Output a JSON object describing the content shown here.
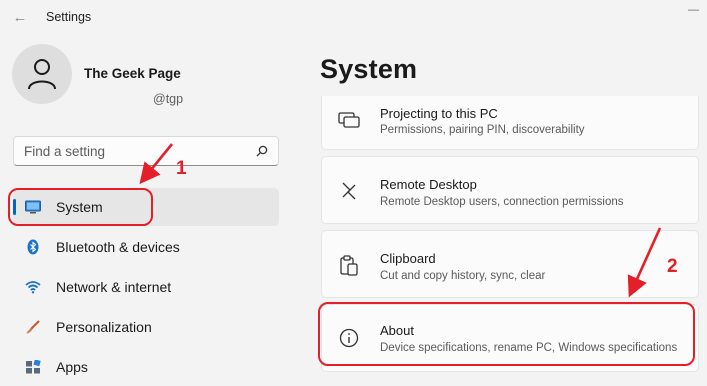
{
  "window": {
    "title": "Settings",
    "back_glyph": "←",
    "minimize_glyph": "—"
  },
  "user": {
    "name": "The Geek Page",
    "handle": "@tgp"
  },
  "search": {
    "placeholder": "Find a setting"
  },
  "nav": {
    "items": [
      {
        "label": "System",
        "icon": "monitor-icon",
        "selected": true
      },
      {
        "label": "Bluetooth & devices",
        "icon": "bluetooth-icon"
      },
      {
        "label": "Network & internet",
        "icon": "wifi-icon"
      },
      {
        "label": "Personalization",
        "icon": "brush-icon"
      },
      {
        "label": "Apps",
        "icon": "apps-icon"
      }
    ]
  },
  "main": {
    "title": "System",
    "cards": [
      {
        "title": "Projecting to this PC",
        "subtitle": "Permissions, pairing PIN, discoverability",
        "icon": "projector-icon"
      },
      {
        "title": "Remote Desktop",
        "subtitle": "Remote Desktop users, connection permissions",
        "icon": "remote-desktop-icon"
      },
      {
        "title": "Clipboard",
        "subtitle": "Cut and copy history, sync, clear",
        "icon": "clipboard-icon"
      },
      {
        "title": "About",
        "subtitle": "Device specifications, rename PC, Windows specifications",
        "icon": "info-icon"
      }
    ]
  },
  "annotations": {
    "step1": "1",
    "step2": "2",
    "color": "#e3202a"
  },
  "colors": {
    "accent": "#0067c0",
    "background": "#f3f3f3"
  }
}
